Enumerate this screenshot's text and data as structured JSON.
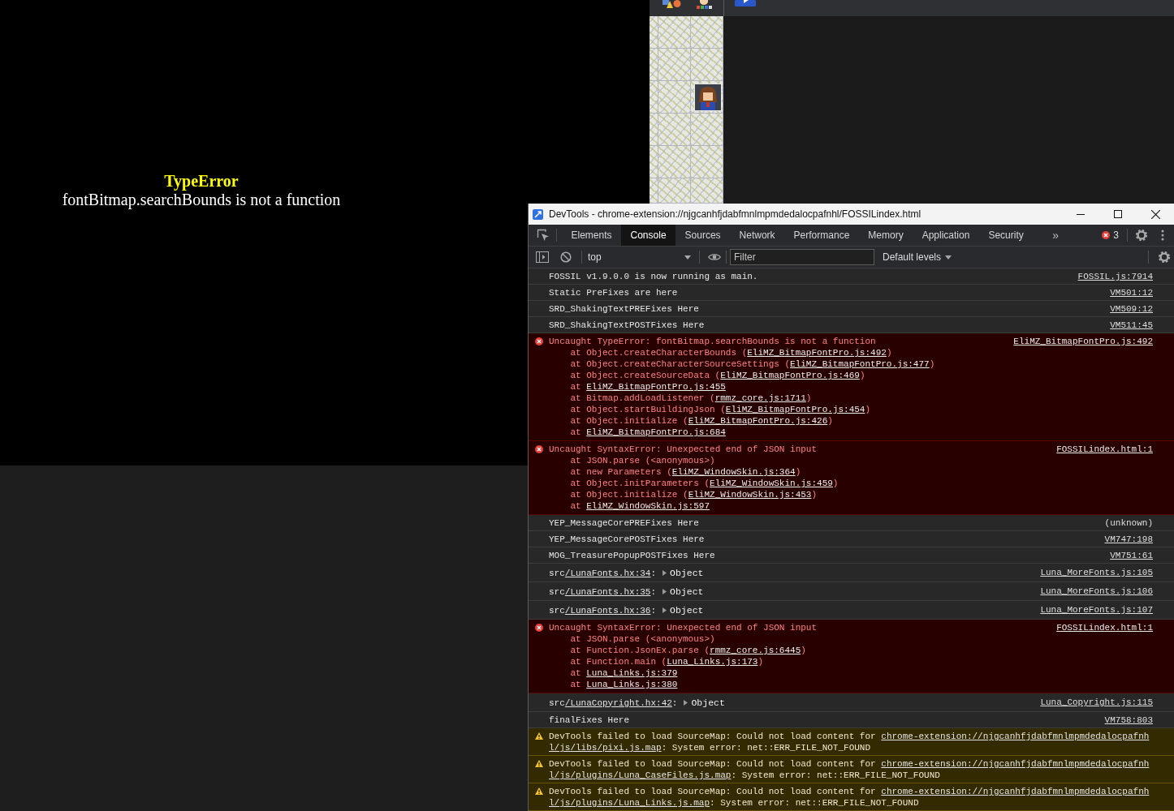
{
  "game_window": {
    "error_title": "TypeError",
    "error_message": "fontBitmap.searchBounds is not a function"
  },
  "devtools": {
    "title": "DevTools - chrome-extension://njgcanhfjdabfmnlmpmdedalocpafnhl/FOSSILindex.html",
    "tabs": [
      {
        "label": "Elements",
        "selected": false
      },
      {
        "label": "Console",
        "selected": true
      },
      {
        "label": "Sources",
        "selected": false
      },
      {
        "label": "Network",
        "selected": false
      },
      {
        "label": "Performance",
        "selected": false
      },
      {
        "label": "Memory",
        "selected": false
      },
      {
        "label": "Application",
        "selected": false
      },
      {
        "label": "Security",
        "selected": false
      }
    ],
    "more_tabs": "»",
    "error_count": "3",
    "context": "top",
    "filter": {
      "placeholder": "Filter"
    },
    "levels": "Default levels",
    "messages": [
      {
        "kind": "log",
        "text": "FOSSIL v1.9.0.0 is now running as main.",
        "source": {
          "text": "FOSSIL.js:7914",
          "linked": true
        }
      },
      {
        "kind": "log",
        "text": "Static PreFixes are here",
        "source": {
          "text": "VM501:12",
          "linked": true
        }
      },
      {
        "kind": "log",
        "text": "SRD_ShakingTextPREFixes Here",
        "source": {
          "text": "VM509:12",
          "linked": true
        }
      },
      {
        "kind": "log",
        "text": "SRD_ShakingTextPOSTFixes Here",
        "source": {
          "text": "VM511:45",
          "linked": true
        }
      },
      {
        "kind": "error",
        "text": "Uncaught TypeError: fontBitmap.searchBounds is not a function",
        "source": {
          "text": "EliMZ_BitmapFontPro.js:492",
          "linked": true
        },
        "frames": [
          {
            "text": "at Object.createCharacterBounds (",
            "link": "EliMZ_BitmapFontPro.js:492",
            "after": ")"
          },
          {
            "text": "at Object.createCharacterSourceSettings (",
            "link": "EliMZ_BitmapFontPro.js:477",
            "after": ")"
          },
          {
            "text": "at Object.createSourceData (",
            "link": "EliMZ_BitmapFontPro.js:469",
            "after": ")"
          },
          {
            "text": "at ",
            "link": "EliMZ_BitmapFontPro.js:455"
          },
          {
            "text": "at Bitmap.addLoadListener (",
            "link": "rmmz_core.js:1711",
            "after": ")"
          },
          {
            "text": "at Object.startBuildingJson (",
            "link": "EliMZ_BitmapFontPro.js:454",
            "after": ")"
          },
          {
            "text": "at Object.initialize (",
            "link": "EliMZ_BitmapFontPro.js:426",
            "after": ")"
          },
          {
            "text": "at ",
            "link": "EliMZ_BitmapFontPro.js:684"
          }
        ]
      },
      {
        "kind": "error",
        "text": "Uncaught SyntaxError: Unexpected end of JSON input",
        "source": {
          "text": "FOSSILindex.html:1",
          "linked": true
        },
        "frames": [
          {
            "text": "at JSON.parse (<anonymous>)"
          },
          {
            "text": "at new Parameters (",
            "link": "EliMZ_WindowSkin.js:364",
            "after": ")"
          },
          {
            "text": "at Object.initParameters (",
            "link": "EliMZ_WindowSkin.js:459",
            "after": ")"
          },
          {
            "text": "at Object.initialize (",
            "link": "EliMZ_WindowSkin.js:453",
            "after": ")"
          },
          {
            "text": "at ",
            "link": "EliMZ_WindowSkin.js:597"
          }
        ]
      },
      {
        "kind": "log",
        "text": "YEP_MessageCorePREFixes Here",
        "source": {
          "text": "(unknown)",
          "linked": false
        }
      },
      {
        "kind": "log",
        "text": "YEP_MessageCorePOSTFixes Here",
        "source": {
          "text": "VM747:198",
          "linked": true
        }
      },
      {
        "kind": "log",
        "text": "MOG_TreasurePopupPOSTFixes Here",
        "source": {
          "text": "VM751:61",
          "linked": true
        }
      },
      {
        "kind": "object",
        "prefix": "src",
        "link": "/LunaFonts.hx:34",
        "suffix": ":",
        "object": "Object",
        "source": {
          "text": "Luna_MoreFonts.js:105",
          "linked": true
        }
      },
      {
        "kind": "object",
        "prefix": "src",
        "link": "/LunaFonts.hx:35",
        "suffix": ":",
        "object": "Object",
        "source": {
          "text": "Luna_MoreFonts.js:106",
          "linked": true
        }
      },
      {
        "kind": "object",
        "prefix": "src",
        "link": "/LunaFonts.hx:36",
        "suffix": ":",
        "object": "Object",
        "source": {
          "text": "Luna_MoreFonts.js:107",
          "linked": true
        }
      },
      {
        "kind": "error",
        "text": "Uncaught SyntaxError: Unexpected end of JSON input",
        "source": {
          "text": "FOSSILindex.html:1",
          "linked": true
        },
        "frames": [
          {
            "text": "at JSON.parse (<anonymous>)"
          },
          {
            "text": "at Function.JsonEx.parse (",
            "link": "rmmz_core.js:6445",
            "after": ")"
          },
          {
            "text": "at Function.main (",
            "link": "Luna_Links.js:173",
            "after": ")"
          },
          {
            "text": "at ",
            "link": "Luna_Links.js:379"
          },
          {
            "text": "at ",
            "link": "Luna_Links.js:380"
          }
        ]
      },
      {
        "kind": "object",
        "prefix": "src",
        "link": "/LunaCopyright.hx:42",
        "suffix": ":",
        "object": "Object",
        "source": {
          "text": "Luna_Copyright.js:115",
          "linked": true
        }
      },
      {
        "kind": "log",
        "text": "finalFixes Here",
        "source": {
          "text": "VM758:803",
          "linked": true
        }
      },
      {
        "kind": "warning",
        "text": "DevTools failed to load SourceMap: Could not load content for",
        "link_lines": [
          "chrome-extension://njgcanhfjdabfmnlmpmdedalocpafnh",
          "l/js/libs/pixi.js.map"
        ],
        "after": ": System error: net::ERR_FILE_NOT_FOUND"
      },
      {
        "kind": "warning",
        "text": "DevTools failed to load SourceMap: Could not load content for",
        "link_lines": [
          "chrome-extension://njgcanhfjdabfmnlmpmdedalocpafnh",
          "l/js/plugins/Luna_CaseFiles.js.map"
        ],
        "after": ": System error: net::ERR_FILE_NOT_FOUND"
      },
      {
        "kind": "warning",
        "text": "DevTools failed to load SourceMap: Could not load content for",
        "link_lines": [
          "chrome-extension://njgcanhfjdabfmnlmpmdedalocpafnh",
          "l/js/plugins/Luna_Links.js.map"
        ],
        "after": ": System error: net::ERR_FILE_NOT_FOUND"
      }
    ]
  }
}
